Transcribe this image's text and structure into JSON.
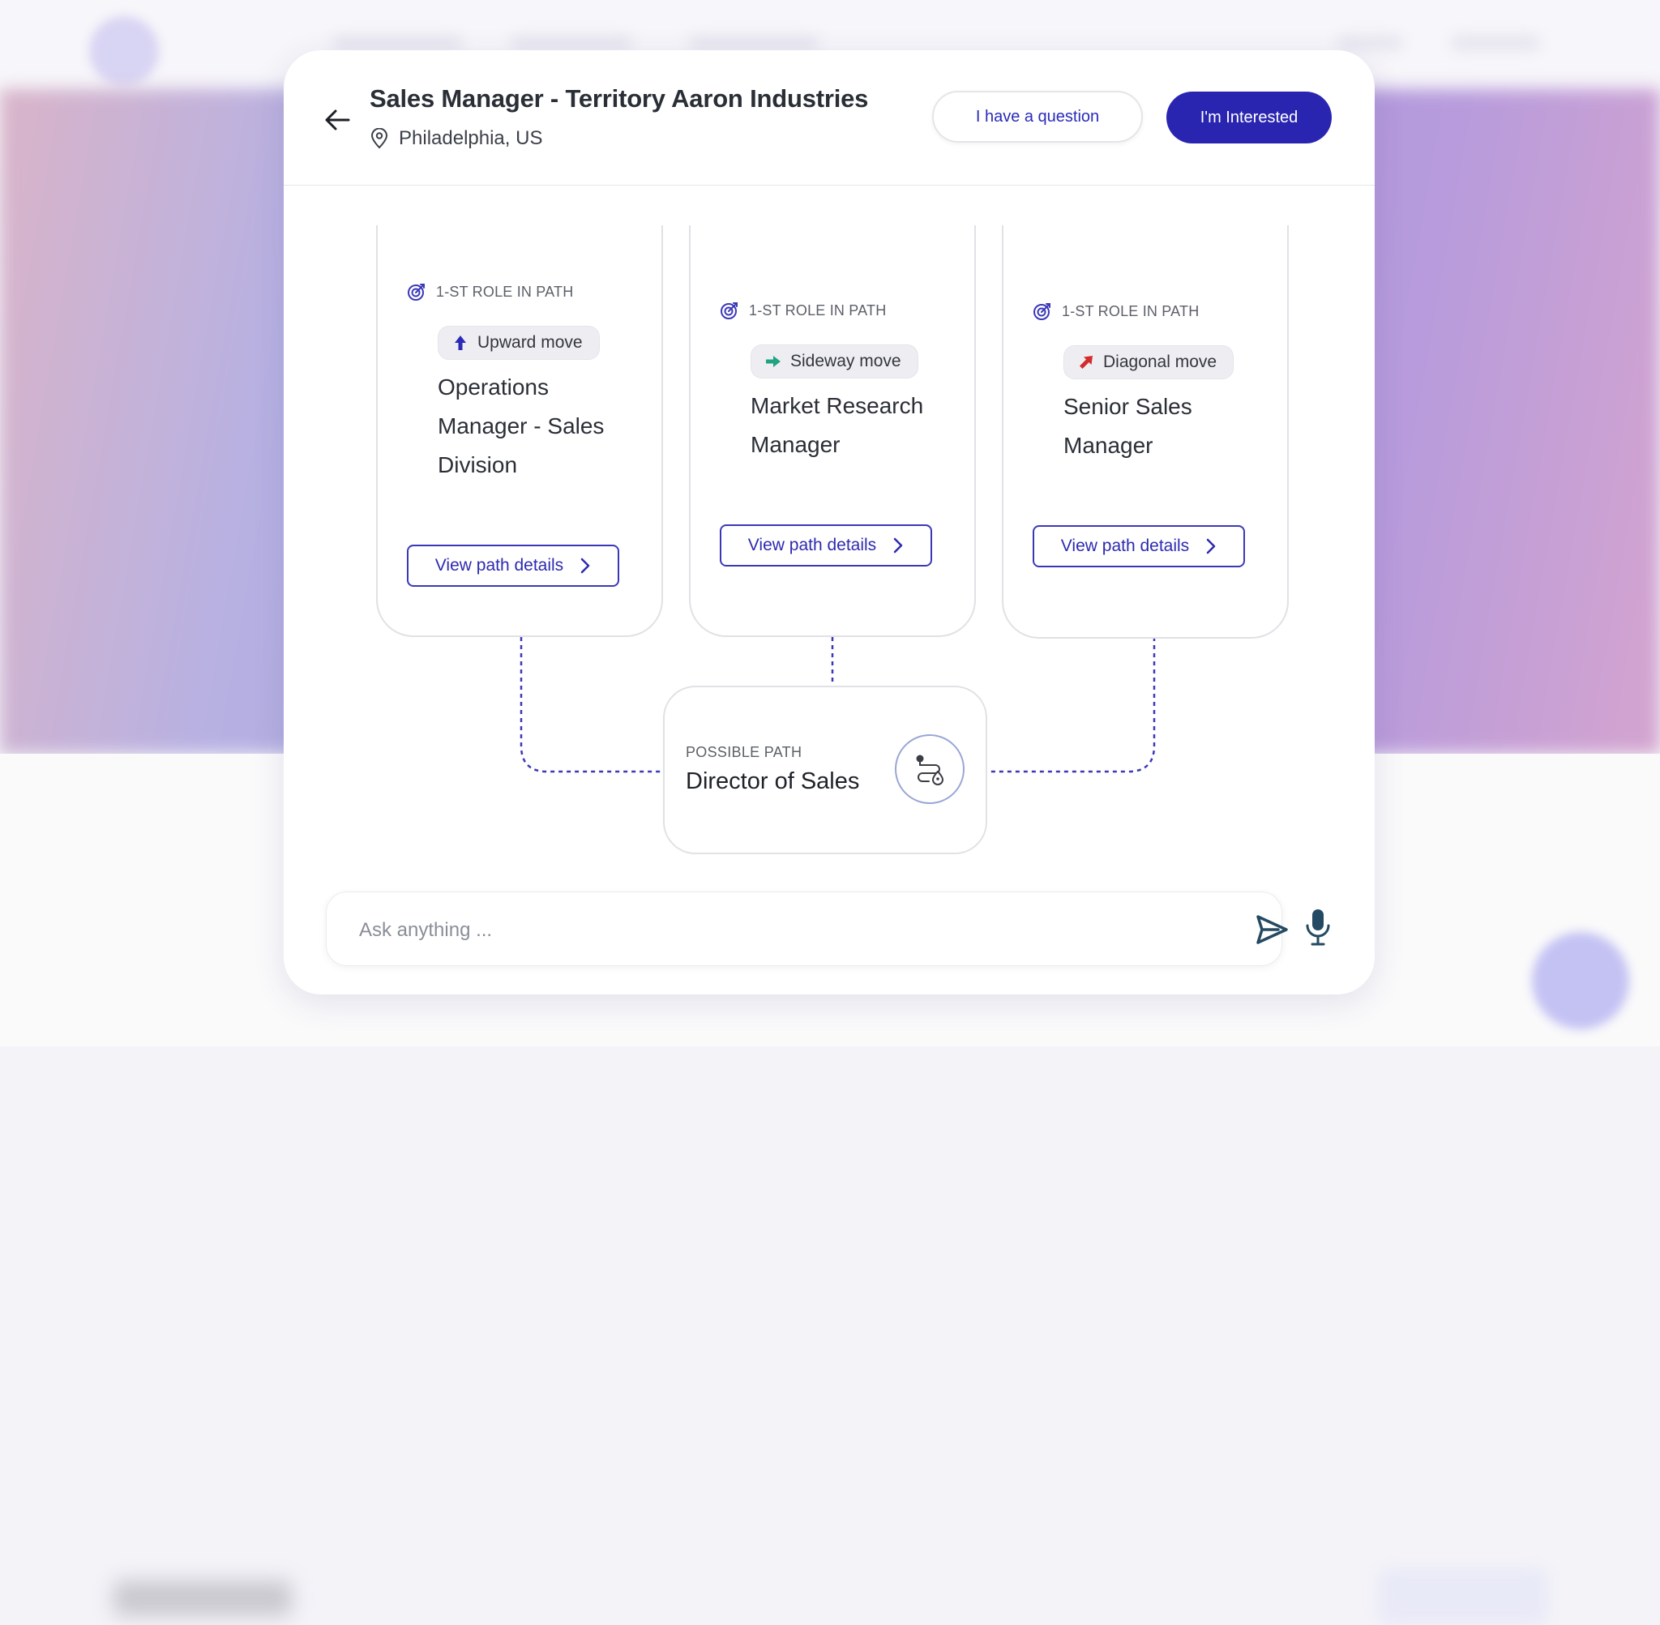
{
  "header": {
    "title": "Sales Manager - Territory Aaron Industries",
    "location": "Philadelphia, US",
    "question_button": "I have a question",
    "interested_button": "I'm Interested"
  },
  "paths": [
    {
      "role_label": "1-ST ROLE IN PATH",
      "move_type": "Upward move",
      "move_icon": "arrow-up-icon",
      "move_color": "#2b2bb8",
      "role_title": "Operations Manager - Sales Division",
      "view_button": "View path details"
    },
    {
      "role_label": "1-ST ROLE IN PATH",
      "move_type": "Sideway move",
      "move_icon": "arrow-right-icon",
      "move_color": "#1fa383",
      "role_title": "Market Research Manager",
      "view_button": "View path details"
    },
    {
      "role_label": "1-ST ROLE IN PATH",
      "move_type": "Diagonal move",
      "move_icon": "arrow-diagonal-icon",
      "move_color": "#d42c2c",
      "role_title": "Senior Sales Manager",
      "view_button": "View path details"
    }
  ],
  "possible_path": {
    "label": "POSSIBLE PATH",
    "title": "Director of Sales",
    "icon": "route-icon"
  },
  "chat": {
    "placeholder": "Ask anything ..."
  },
  "colors": {
    "accent": "#2a25b0",
    "connector": "#3b38b8"
  }
}
